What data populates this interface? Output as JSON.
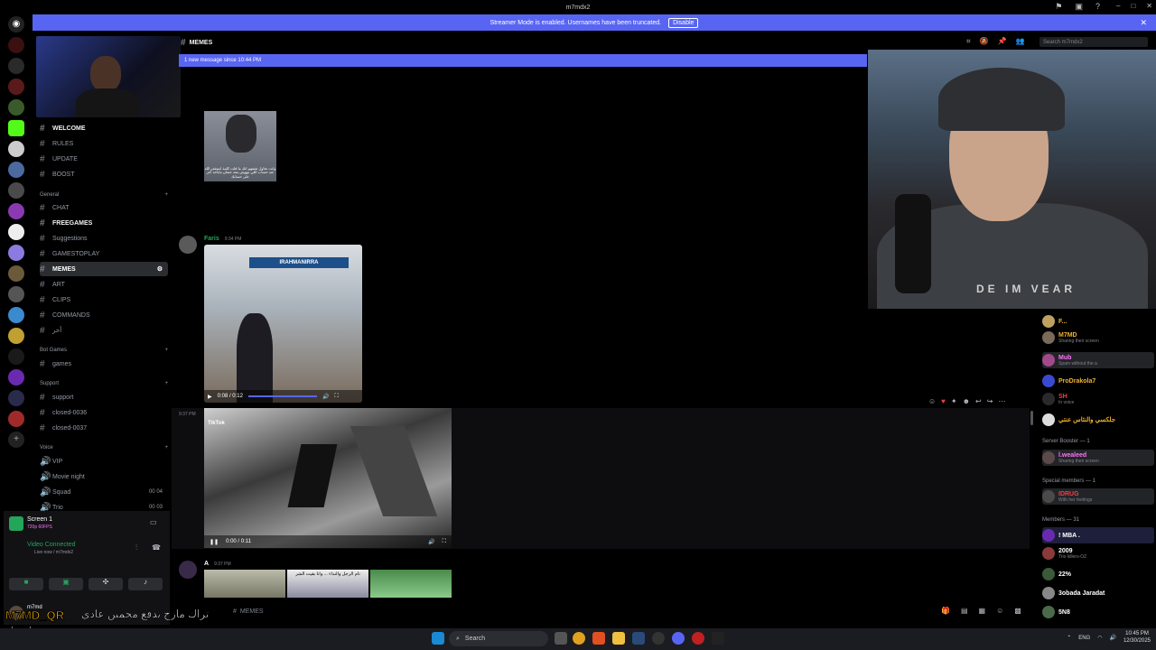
{
  "window": {
    "title": "m7mdx2"
  },
  "banner": {
    "text": "Streamer Mode is enabled. Usernames have been truncated.",
    "button": "Disable"
  },
  "channels": [
    {
      "name": "WELCOME",
      "bold": true
    },
    {
      "name": "RULES",
      "bold": false
    },
    {
      "name": "UPDATE",
      "bold": false
    },
    {
      "name": "BOOST",
      "bold": false
    }
  ],
  "categories": {
    "general": "General",
    "bot_games": "Bot Games",
    "support": "Support",
    "voice": "Voice"
  },
  "general_channels": [
    {
      "name": "CHAT",
      "bold": false
    },
    {
      "name": "FREEGAMES",
      "bold": true
    },
    {
      "name": "Suggestions",
      "bold": false
    },
    {
      "name": "GAMESTOPLAY",
      "bold": false
    },
    {
      "name": "MEMES",
      "bold": true,
      "selected": true
    },
    {
      "name": "ART",
      "bold": false
    },
    {
      "name": "CLIPS",
      "bold": false
    },
    {
      "name": "COMMANDS",
      "bold": false
    },
    {
      "name": "أخر",
      "bold": false
    }
  ],
  "bot_channels": [
    {
      "name": "games"
    }
  ],
  "support_channels": [
    {
      "name": "support"
    },
    {
      "name": "closed-0036"
    },
    {
      "name": "closed-0037"
    }
  ],
  "voice_channels": [
    {
      "name": "VIP"
    },
    {
      "name": "Movie night"
    },
    {
      "name": "Squad"
    },
    {
      "name": "Trio"
    }
  ],
  "voice_counts": [
    {
      "a": "00",
      "b": "04"
    },
    {
      "a": "00",
      "b": "03"
    }
  ],
  "voice_panel": {
    "stream_title": "Screen 1",
    "stream_sub": "720p 60FPS",
    "status": "Video Connected",
    "status_sub": "Live now / m7mdx2"
  },
  "user": {
    "name": "m7md"
  },
  "chat": {
    "channel": "MEMES",
    "new_message": "1 new message since 10:44 PM",
    "search_placeholder": "Search m7mdx2",
    "gorilla_caption": "وانت تحاول تقنعهم انك ما قلت كلمة استغفر الله عند حساب اللي مهوش معه عشان مايأخذ أجر على حسابك",
    "msg1_author": "Faris",
    "msg1_time": "9:34 PM",
    "video1_sign": "IRAHMANIRRA",
    "video1_time": "0:08 / 0:12",
    "msg2_time": "9:37 PM",
    "video2_time": "0:00 / 0:11",
    "video2_watermark": "TikTok",
    "msg3_author": "A",
    "msg3_time": "9:37 PM",
    "thumb2_text": "تام الرجل والنداء ... وانا بقيت الشر",
    "input_placeholder": "MEMES"
  },
  "members": {
    "top": [
      {
        "name": "F...",
        "sub": "",
        "color": "#f0b232"
      },
      {
        "name": "M7MD",
        "sub": "Sharing their screen",
        "color": "#f0b232"
      },
      {
        "name": "Mub",
        "sub": "Spam without the a",
        "color": "#ff73fa"
      },
      {
        "name": "ProDrakola7",
        "sub": "",
        "color": "#f0b232"
      },
      {
        "name": "SH",
        "sub": "In voice",
        "color": "#f23f43"
      },
      {
        "name": "جلكسي والنثاس عنتي",
        "sub": "",
        "color": "#f0b232"
      }
    ],
    "booster_header": "Server Booster — 1",
    "booster": [
      {
        "name": "l.wealeed",
        "sub": "Sharing their screen",
        "color": "#ff73fa"
      }
    ],
    "special_header": "Special members — 1",
    "special": [
      {
        "name": "IDRUG",
        "sub": "With her feelings",
        "color": "#f23f43"
      }
    ],
    "members_header": "Members — 31",
    "list": [
      {
        "name": "! MBA .",
        "sub": "",
        "color": "#ffffff"
      },
      {
        "name": "2009",
        "sub": "Trio killers-OZ",
        "color": "#ffffff"
      },
      {
        "name": "22%",
        "sub": "",
        "color": "#ffffff"
      },
      {
        "name": "3obada Jaradat",
        "sub": "",
        "color": "#ffffff"
      },
      {
        "name": "5N8",
        "sub": "",
        "color": "#ffffff"
      }
    ]
  },
  "taskbar": {
    "search": "Search",
    "lang": "ENG",
    "time": "10:45 PM",
    "date": "12/30/2025"
  },
  "overlay": {
    "tag": "M7MD_QR",
    "line1": "تراك مازح تدفع محمين عادي",
    "line2": "اضحك"
  }
}
